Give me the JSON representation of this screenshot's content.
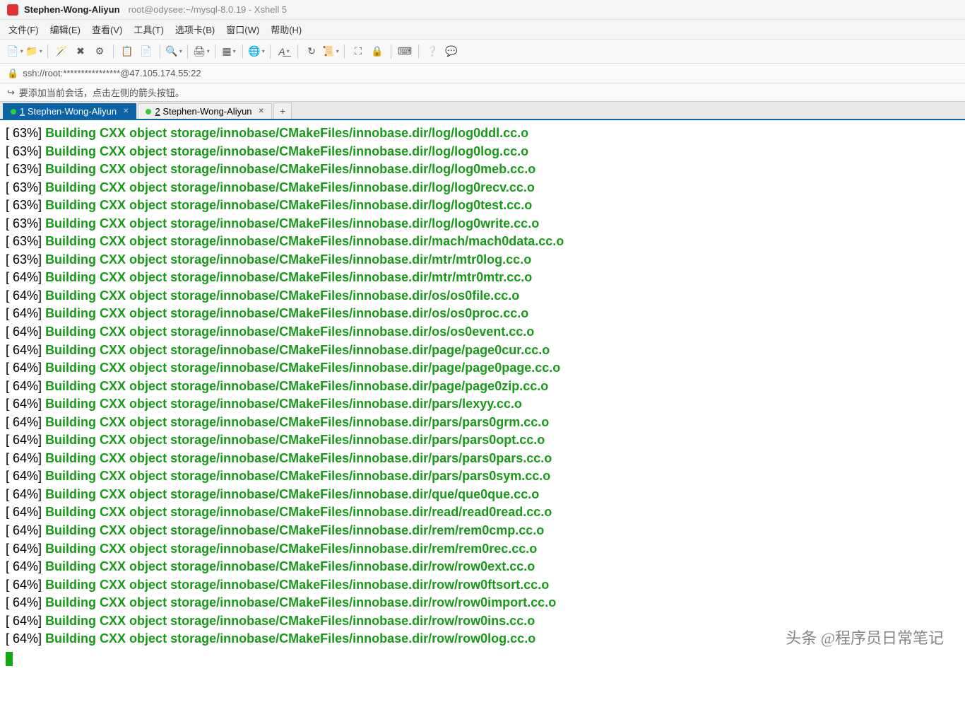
{
  "title": {
    "session": "Stephen-Wong-Aliyun",
    "path": "root@odysee:~/mysql-8.0.19 - Xshell 5"
  },
  "menu": {
    "file": "文件(F)",
    "edit": "编辑(E)",
    "view": "查看(V)",
    "tools": "工具(T)",
    "tabs": "选项卡(B)",
    "window": "窗口(W)",
    "help": "帮助(H)"
  },
  "address": "ssh://root:****************@47.105.174.55:22",
  "session_hint": "要添加当前会话，点击左侧的箭头按钮。",
  "tabs": {
    "t1_num": "1",
    "t1_label": " Stephen-Wong-Aliyun",
    "t2_num": "2",
    "t2_label": " Stephen-Wong-Aliyun",
    "add": "+"
  },
  "term": {
    "build_prefix": "Building CXX object",
    "path_prefix": "storage/innobase/CMakeFiles/innobase.dir/",
    "lines": [
      {
        "pct": "63%",
        "file": "log/log0ddl.cc.o"
      },
      {
        "pct": "63%",
        "file": "log/log0log.cc.o"
      },
      {
        "pct": "63%",
        "file": "log/log0meb.cc.o"
      },
      {
        "pct": "63%",
        "file": "log/log0recv.cc.o"
      },
      {
        "pct": "63%",
        "file": "log/log0test.cc.o"
      },
      {
        "pct": "63%",
        "file": "log/log0write.cc.o"
      },
      {
        "pct": "63%",
        "file": "mach/mach0data.cc.o"
      },
      {
        "pct": "63%",
        "file": "mtr/mtr0log.cc.o"
      },
      {
        "pct": "64%",
        "file": "mtr/mtr0mtr.cc.o"
      },
      {
        "pct": "64%",
        "file": "os/os0file.cc.o"
      },
      {
        "pct": "64%",
        "file": "os/os0proc.cc.o"
      },
      {
        "pct": "64%",
        "file": "os/os0event.cc.o"
      },
      {
        "pct": "64%",
        "file": "page/page0cur.cc.o"
      },
      {
        "pct": "64%",
        "file": "page/page0page.cc.o"
      },
      {
        "pct": "64%",
        "file": "page/page0zip.cc.o"
      },
      {
        "pct": "64%",
        "file": "pars/lexyy.cc.o"
      },
      {
        "pct": "64%",
        "file": "pars/pars0grm.cc.o"
      },
      {
        "pct": "64%",
        "file": "pars/pars0opt.cc.o"
      },
      {
        "pct": "64%",
        "file": "pars/pars0pars.cc.o"
      },
      {
        "pct": "64%",
        "file": "pars/pars0sym.cc.o"
      },
      {
        "pct": "64%",
        "file": "que/que0que.cc.o"
      },
      {
        "pct": "64%",
        "file": "read/read0read.cc.o"
      },
      {
        "pct": "64%",
        "file": "rem/rem0cmp.cc.o"
      },
      {
        "pct": "64%",
        "file": "rem/rem0rec.cc.o"
      },
      {
        "pct": "64%",
        "file": "row/row0ext.cc.o"
      },
      {
        "pct": "64%",
        "file": "row/row0ftsort.cc.o"
      },
      {
        "pct": "64%",
        "file": "row/row0import.cc.o"
      },
      {
        "pct": "64%",
        "file": "row/row0ins.cc.o"
      },
      {
        "pct": "64%",
        "file": "row/row0log.cc.o"
      }
    ]
  },
  "watermark": "头条 @程序员日常笔记"
}
